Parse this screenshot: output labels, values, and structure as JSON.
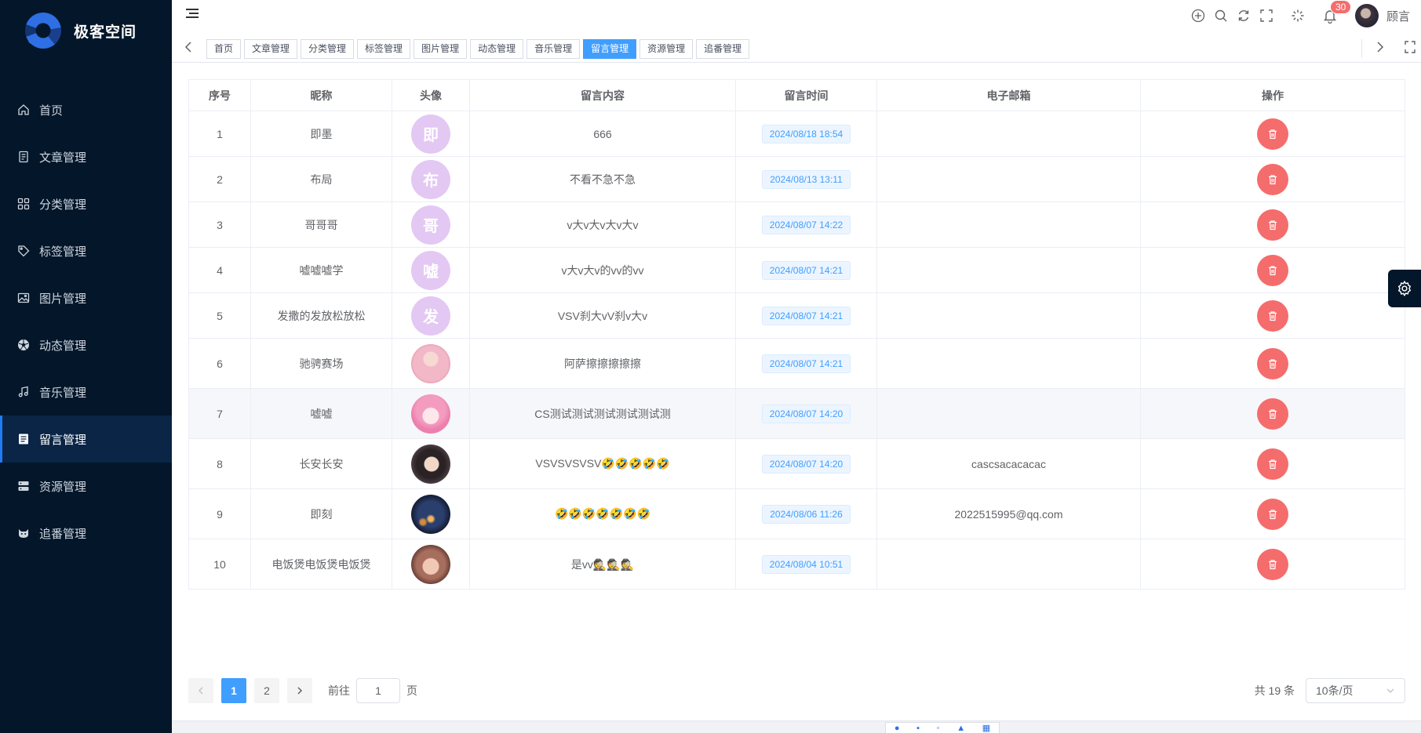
{
  "brand": {
    "name": "极客空间"
  },
  "sidebar": {
    "items": [
      {
        "label": "首页",
        "icon": "home-icon",
        "active": false
      },
      {
        "label": "文章管理",
        "icon": "document-icon",
        "active": false
      },
      {
        "label": "分类管理",
        "icon": "grid-icon",
        "active": false
      },
      {
        "label": "标签管理",
        "icon": "tag-icon",
        "active": false
      },
      {
        "label": "图片管理",
        "icon": "image-icon",
        "active": false
      },
      {
        "label": "动态管理",
        "icon": "aperture-icon",
        "active": false
      },
      {
        "label": "音乐管理",
        "icon": "music-icon",
        "active": false
      },
      {
        "label": "留言管理",
        "icon": "message-icon",
        "active": true
      },
      {
        "label": "资源管理",
        "icon": "storage-icon",
        "active": false
      },
      {
        "label": "追番管理",
        "icon": "cat-icon",
        "active": false
      }
    ]
  },
  "header": {
    "notification_count": "30",
    "user_name": "顾言"
  },
  "tabs": [
    {
      "label": "首页",
      "active": false
    },
    {
      "label": "文章管理",
      "active": false
    },
    {
      "label": "分类管理",
      "active": false
    },
    {
      "label": "标签管理",
      "active": false
    },
    {
      "label": "图片管理",
      "active": false
    },
    {
      "label": "动态管理",
      "active": false
    },
    {
      "label": "音乐管理",
      "active": false
    },
    {
      "label": "留言管理",
      "active": true
    },
    {
      "label": "资源管理",
      "active": false
    },
    {
      "label": "追番管理",
      "active": false
    }
  ],
  "table": {
    "columns": [
      "序号",
      "昵称",
      "头像",
      "留言内容",
      "留言时间",
      "电子邮箱",
      "操作"
    ],
    "rows": [
      {
        "index": "1",
        "nickname": "即墨",
        "avatar_text": "即",
        "avatar_type": "text",
        "content": "666",
        "time": "2024/08/18 18:54",
        "email": ""
      },
      {
        "index": "2",
        "nickname": "布局",
        "avatar_text": "布",
        "avatar_type": "text",
        "content": "不看不急不急",
        "time": "2024/08/13 13:11",
        "email": ""
      },
      {
        "index": "3",
        "nickname": "哥哥哥",
        "avatar_text": "哥",
        "avatar_type": "text",
        "content": "v大v大v大v大v",
        "time": "2024/08/07 14:22",
        "email": ""
      },
      {
        "index": "4",
        "nickname": "嘘嘘嘘学",
        "avatar_text": "嘘",
        "avatar_type": "text",
        "content": "v大v大v的vv的vv",
        "time": "2024/08/07 14:21",
        "email": ""
      },
      {
        "index": "5",
        "nickname": "发撒的发放松放松",
        "avatar_text": "发",
        "avatar_type": "text",
        "content": "VSV刹大vV刹v大v",
        "time": "2024/08/07 14:21",
        "email": ""
      },
      {
        "index": "6",
        "nickname": "驰骋赛场",
        "avatar_text": "",
        "avatar_type": "photo-pink",
        "content": "阿萨擦擦擦擦擦",
        "time": "2024/08/07 14:21",
        "email": ""
      },
      {
        "index": "7",
        "nickname": "嘘嘘",
        "avatar_text": "",
        "avatar_type": "photo-anime",
        "content": "CS测试测试测试测试测试测",
        "time": "2024/08/07 14:20",
        "email": ""
      },
      {
        "index": "8",
        "nickname": "长安长安",
        "avatar_text": "",
        "avatar_type": "photo-girl",
        "content": "VSVSVSVSV🤣🤣🤣🤣🤣",
        "time": "2024/08/07 14:20",
        "email": "cascsacacacac"
      },
      {
        "index": "9",
        "nickname": "即刻",
        "avatar_text": "",
        "avatar_type": "photo-night",
        "content": "🤣🤣🤣🤣🤣🤣🤣",
        "time": "2024/08/06 11:26",
        "email": "2022515995@qq.com"
      },
      {
        "index": "10",
        "nickname": "电饭煲电饭煲电饭煲",
        "avatar_text": "",
        "avatar_type": "photo-child",
        "content": "是vv🕵️🕵️🕵️",
        "time": "2024/08/04 10:51",
        "email": ""
      }
    ]
  },
  "pagination": {
    "pages": [
      "1",
      "2"
    ],
    "current": "1",
    "goto_label": "前往",
    "goto_value": "1",
    "page_suffix": "页",
    "total_text": "共 19 条",
    "page_size": "10条/页"
  },
  "colors": {
    "sidebar_bg": "#03162a",
    "accent": "#409eff",
    "danger": "#f56c6c"
  }
}
